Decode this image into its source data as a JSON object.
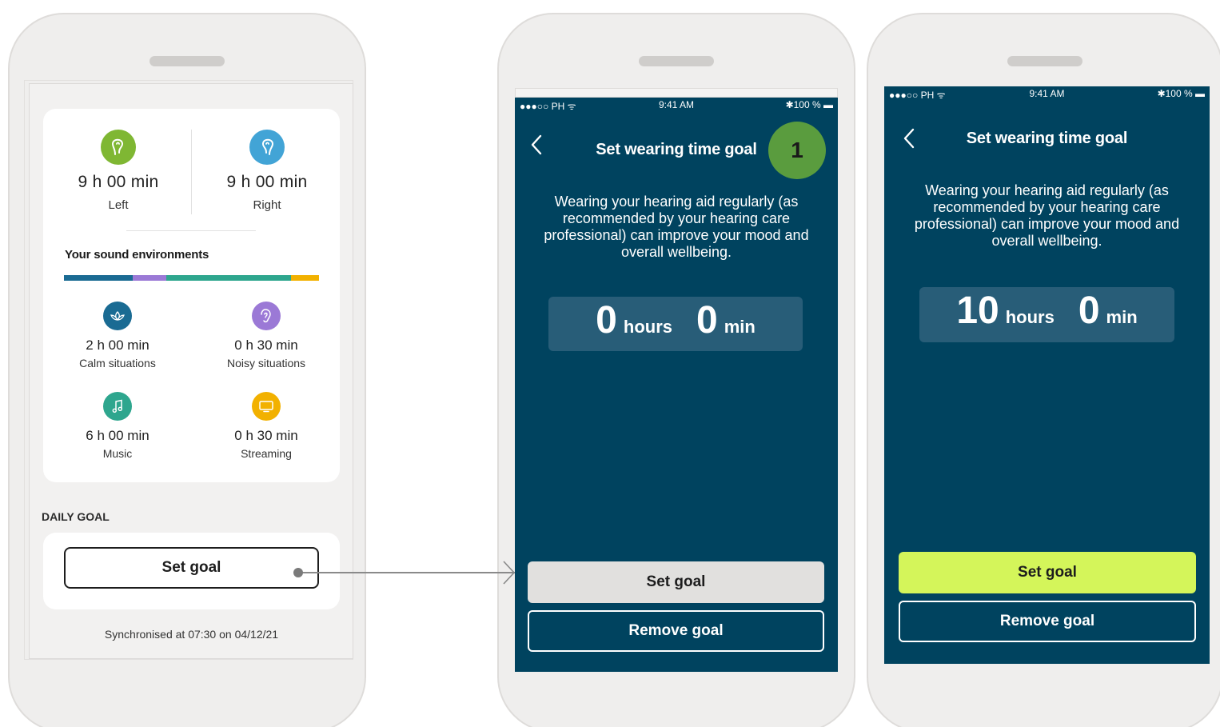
{
  "screen1": {
    "left_ear": {
      "value": "9 h 00 min",
      "label": "Left",
      "color": "#7fb733"
    },
    "right_ear": {
      "value": "9 h 00 min",
      "label": "Right",
      "color": "#42a4d6"
    },
    "env_title": "Your sound environments",
    "env_bar": [
      {
        "name": "Calm situations",
        "color": "#1a6b93",
        "fraction": 0.27
      },
      {
        "name": "Noisy situations",
        "color": "#9b79d6",
        "fraction": 0.13
      },
      {
        "name": "Music",
        "color": "#2ea68e",
        "fraction": 0.49
      },
      {
        "name": "Streaming",
        "color": "#f2b100",
        "fraction": 0.11
      }
    ],
    "environments": [
      {
        "value": "2 h 00 min",
        "label": "Calm situations",
        "color": "#1a6b93",
        "icon": "lotus-icon"
      },
      {
        "value": "0 h 30 min",
        "label": "Noisy situations",
        "color": "#9b79d6",
        "icon": "ear-icon"
      },
      {
        "value": "6 h 00 min",
        "label": "Music",
        "color": "#2ea68e",
        "icon": "music-note-icon"
      },
      {
        "value": "0 h 30 min",
        "label": "Streaming",
        "color": "#f2b100",
        "icon": "tv-icon"
      }
    ],
    "daily_goal_heading": "DAILY GOAL",
    "set_goal_label": "Set goal",
    "sync_text": "Synchronised at 07:30 on 04/12/21"
  },
  "screen2": {
    "status": {
      "carrier": "●●●○○ PH ᯤ",
      "time": "9:41 AM",
      "battery": "✱100 % ▬"
    },
    "title": "Set wearing time goal",
    "badge": "1",
    "description": "Wearing your hearing aid regularly (as recommended by your hearing care professional) can improve your mood and overall wellbeing.",
    "hours_value": "0",
    "hours_unit": "hours",
    "min_value": "0",
    "min_unit": "min",
    "set_goal_label": "Set goal",
    "remove_goal_label": "Remove goal"
  },
  "screen3": {
    "status": {
      "carrier": "●●●○○ PH ᯤ",
      "time": "9:41 AM",
      "battery": "✱100 % ▬"
    },
    "title": "Set wearing time goal",
    "description": "Wearing your hearing aid regularly (as recommended by your hearing care professional) can improve your mood and overall wellbeing.",
    "hours_value": "10",
    "hours_unit": "hours",
    "min_value": "0",
    "min_unit": "min",
    "set_goal_label": "Set goal",
    "remove_goal_label": "Remove goal"
  },
  "colors": {
    "dark_bg": "#00435f",
    "accent_green": "#d4f55a",
    "disabled_button": "#e1e0de"
  }
}
